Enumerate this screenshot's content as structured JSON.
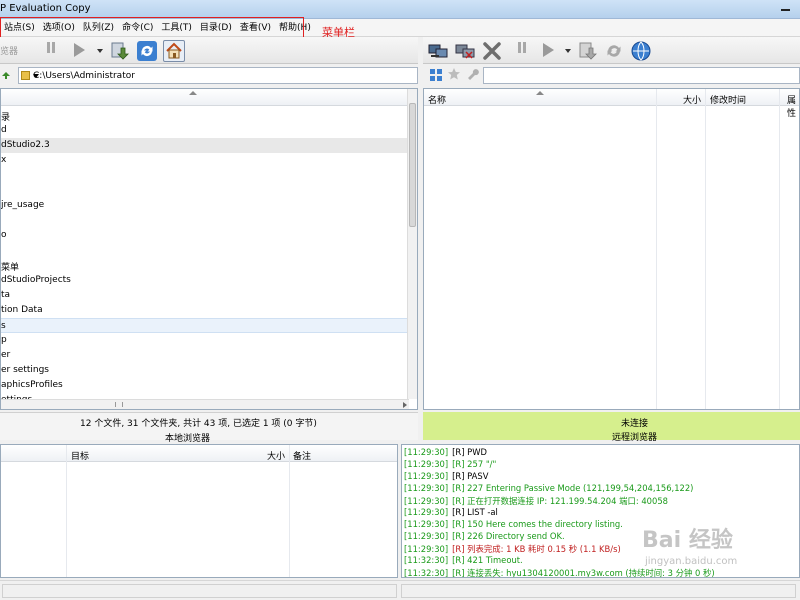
{
  "window": {
    "title": "P Evaluation Copy"
  },
  "menubar": {
    "items": [
      "站点(S)",
      "选项(O)",
      "队列(Z)",
      "命令(C)",
      "工具(T)",
      "目录(D)",
      "查看(V)",
      "帮助(H)"
    ],
    "annotation": "菜单栏",
    "highlight_color": "#e02020"
  },
  "toolbar_left": {
    "label": "览器"
  },
  "path_left": {
    "value": "C:\\Users\\Administrator"
  },
  "file_list_left": [
    {
      "name": "录",
      "state": ""
    },
    {
      "name": "d",
      "state": ""
    },
    {
      "name": "dStudio2.3",
      "state": "selected"
    },
    {
      "name": "x",
      "state": ""
    },
    {
      "name": "",
      "state": ""
    },
    {
      "name": "",
      "state": ""
    },
    {
      "name": "jre_usage",
      "state": ""
    },
    {
      "name": "",
      "state": ""
    },
    {
      "name": "o",
      "state": ""
    },
    {
      "name": "",
      "state": ""
    },
    {
      "name": "菜单",
      "state": ""
    },
    {
      "name": "dStudioProjects",
      "state": ""
    },
    {
      "name": "ta",
      "state": ""
    },
    {
      "name": "tion Data",
      "state": ""
    },
    {
      "name": "s",
      "state": "focused"
    },
    {
      "name": "p",
      "state": ""
    },
    {
      "name": "er",
      "state": ""
    },
    {
      "name": "er settings",
      "state": ""
    },
    {
      "name": "aphicsProfiles",
      "state": ""
    },
    {
      "name": "ettings",
      "state": ""
    }
  ],
  "remote_list": {
    "columns": [
      "名称",
      "大小",
      "修改时间",
      "属性"
    ]
  },
  "status_left": {
    "summary": "12 个文件, 31 个文件夹, 共计 43 项, 已选定 1 项 (0 字节)",
    "label": "本地浏览器"
  },
  "status_right": {
    "state": "未连接",
    "label": "远程浏览器",
    "color": "#d6ef8d"
  },
  "queue": {
    "columns": [
      "目标",
      "大小",
      "备注"
    ]
  },
  "log": [
    {
      "ts": "[11:29:30]",
      "text": "[R] PWD",
      "color": "#000000"
    },
    {
      "ts": "[11:29:30]",
      "text": "[R] 257 \"/\"",
      "color": "#1a9a1a"
    },
    {
      "ts": "[11:29:30]",
      "text": "[R] PASV",
      "color": "#000000"
    },
    {
      "ts": "[11:29:30]",
      "text": "[R] 227 Entering Passive Mode (121,199,54,204,156,122)",
      "color": "#1a9a1a"
    },
    {
      "ts": "[11:29:30]",
      "text": "[R] 正在打开数据连接 IP: 121.199.54.204 端口: 40058",
      "color": "#1a9a1a"
    },
    {
      "ts": "[11:29:30]",
      "text": "[R] LIST -al",
      "color": "#000000"
    },
    {
      "ts": "[11:29:30]",
      "text": "[R] 150 Here comes the directory listing.",
      "color": "#1a9a1a"
    },
    {
      "ts": "[11:29:30]",
      "text": "[R] 226 Directory send OK.",
      "color": "#1a9a1a"
    },
    {
      "ts": "[11:29:30]",
      "text": "[R] 列表完成: 1 KB 耗时 0.15 秒 (1.1 KB/s)",
      "color": "#c02020"
    },
    {
      "ts": "[11:32:30]",
      "text": "[R] 421 Timeout.",
      "color": "#1a9a1a"
    },
    {
      "ts": "[11:32:30]",
      "text": "[R] 连接丢失: hyu1304120001.my3w.com (持续时间: 3 分钟 0 秒)",
      "color": "#1a9a1a"
    }
  ],
  "watermark": {
    "text": "Bai 经验",
    "url": "jingyan.baidu.com"
  }
}
